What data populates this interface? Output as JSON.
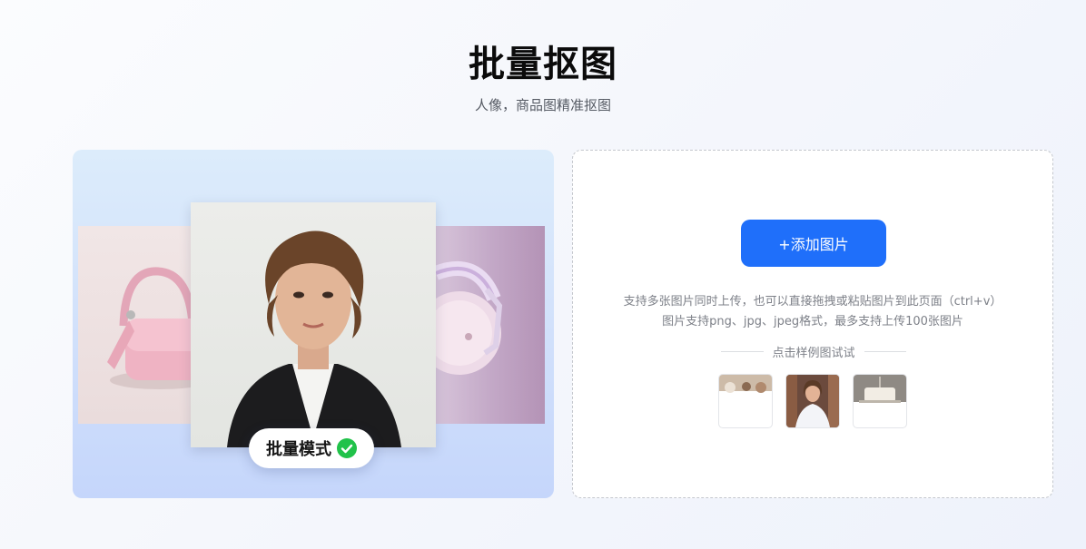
{
  "header": {
    "title": "批量抠图",
    "subtitle": "人像，商品图精准抠图"
  },
  "showcase": {
    "badge_label": "批量模式",
    "badge_icon": "check-circle-icon",
    "cards": [
      "handbag-photo",
      "portrait-photo",
      "headphones-photo"
    ]
  },
  "upload": {
    "button_label": "+添加图片",
    "hint_line_1": "支持多张图片同时上传，也可以直接拖拽或粘贴图片到此页面（ctrl+v）",
    "hint_line_2": "图片支持png、jpg、jpeg格式，最多支持上传100张图片",
    "sample_label": "点击样例图试试",
    "samples": [
      "sample-people-photo",
      "sample-woman-photo",
      "sample-food-photo"
    ]
  },
  "colors": {
    "accent": "#1f6ffa",
    "check_green": "#21c24a"
  }
}
